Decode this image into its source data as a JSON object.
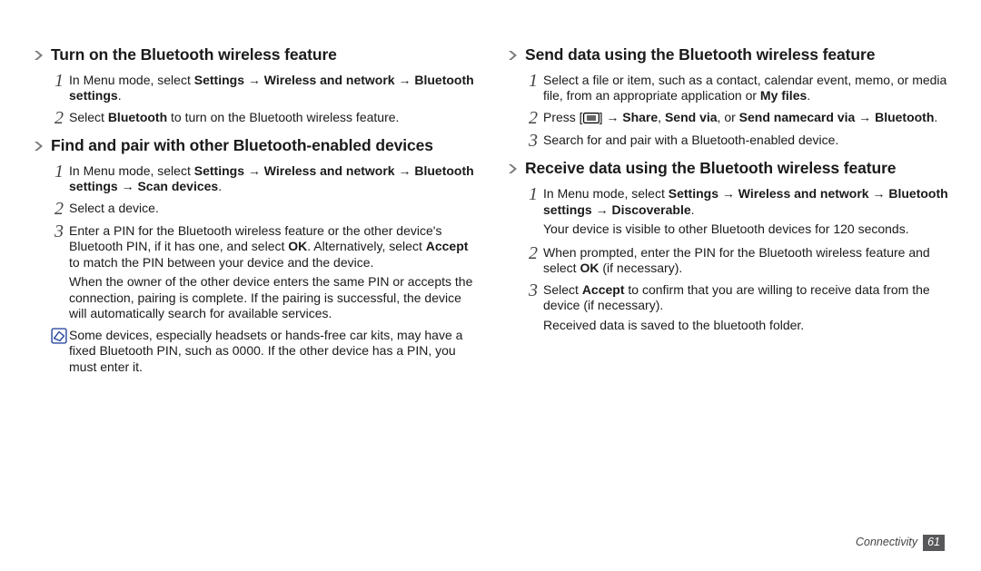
{
  "footer": {
    "section": "Connectivity",
    "page": "61"
  },
  "left": {
    "s1": {
      "title": "Turn on the Bluetooth wireless feature",
      "step1": "In Menu mode, select <b>Settings</b> → <b>Wireless and network</b> → <b>Bluetooth settings</b>.",
      "step2": "Select <b>Bluetooth</b> to turn on the Bluetooth wireless feature."
    },
    "s2": {
      "title": "Find and pair with other Bluetooth-enabled devices",
      "step1": "In Menu mode, select <b>Settings</b> → <b>Wireless and network</b> → <b>Bluetooth settings</b> → <b>Scan devices</b>.",
      "step2": "Select a device.",
      "step3": "Enter a PIN for the Bluetooth wireless feature or the other device's Bluetooth PIN, if it has one, and select <b>OK</b>. Alternatively, select <b>Accept</b> to match the PIN between your device and the device.",
      "step3_sub": "When the owner of the other device enters the same PIN or accepts the connection, pairing is complete. If the pairing is successful, the device will automatically search for available services.",
      "note": "Some devices, especially headsets or hands-free car kits, may have a fixed Bluetooth PIN, such as 0000. If the other device has a PIN, you must enter it."
    }
  },
  "right": {
    "s3": {
      "title": "Send data using the Bluetooth wireless feature",
      "step1": "Select a file or item, such as a contact, calendar event, memo, or media file, from an appropriate application or <b>My files</b>.",
      "step2_pre": "Press [",
      "step2_post": "] → <b>Share</b>, <b>Send via</b>, or <b>Send namecard via</b> → <b>Bluetooth</b>.",
      "step3": "Search for and pair with a Bluetooth-enabled device."
    },
    "s4": {
      "title": "Receive data using the Bluetooth wireless feature",
      "step1": "In Menu mode, select <b>Settings</b> → <b>Wireless and network</b> → <b>Bluetooth settings</b> → <b>Discoverable</b>.",
      "step1_sub": "Your device is visible to other Bluetooth devices for 120 seconds.",
      "step2": "When prompted, enter the PIN for the Bluetooth wireless feature and select <b>OK</b> (if necessary).",
      "step3": "Select <b>Accept</b> to confirm that you are willing to receive data from the device (if necessary).",
      "step3_sub": "Received data is saved to the bluetooth folder."
    }
  }
}
